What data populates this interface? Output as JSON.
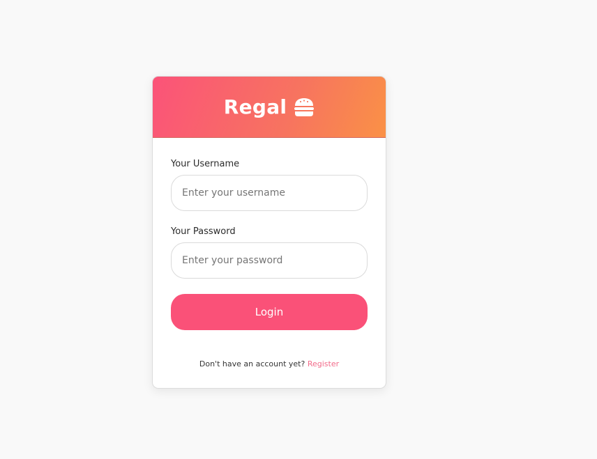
{
  "brand": {
    "name": "Regal",
    "icon": "burger-icon",
    "gradient_start": "#fb5379",
    "gradient_end": "#fa9146"
  },
  "form": {
    "username_label": "Your Username",
    "username_placeholder": "Enter your username",
    "username_value": "",
    "password_label": "Your Password",
    "password_placeholder": "Enter your password",
    "password_value": "",
    "login_label": "Login",
    "login_color": "#fa5178"
  },
  "footer": {
    "prompt": "Don't have an account yet?",
    "register_label": "Register",
    "register_color": "#f26b8a"
  }
}
